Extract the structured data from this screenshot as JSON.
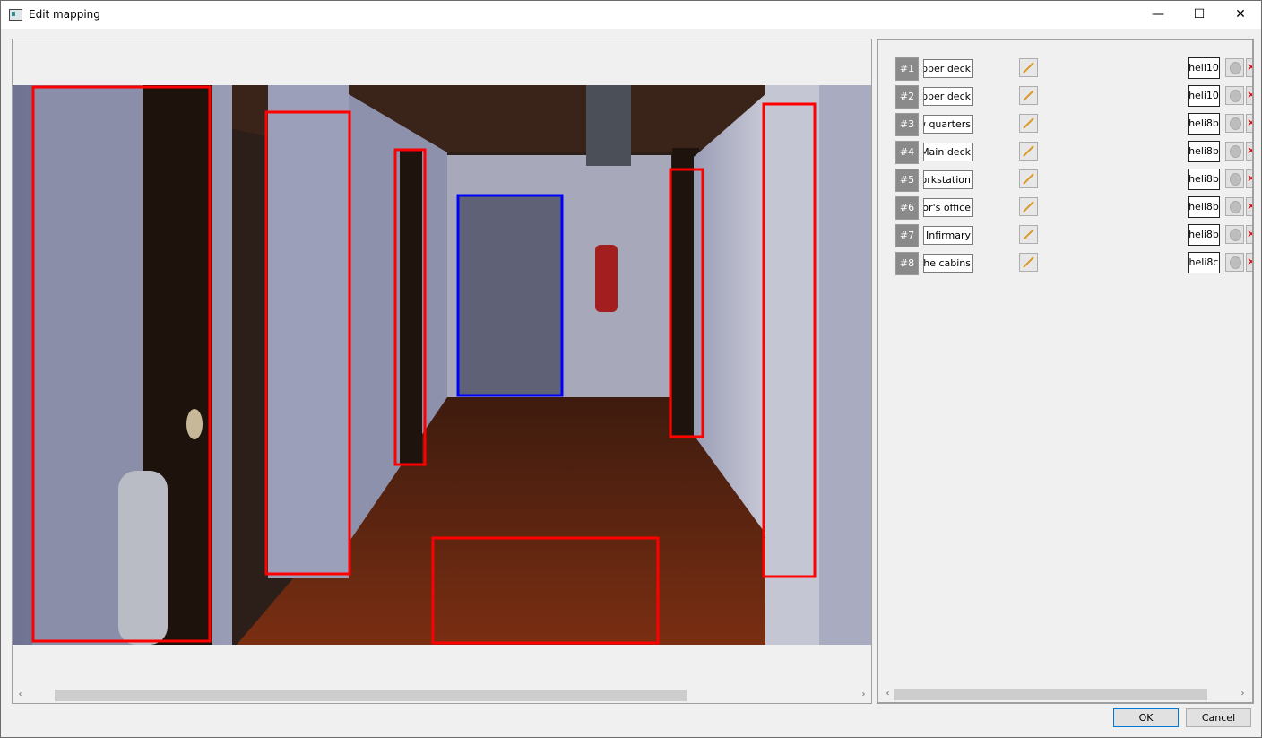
{
  "window": {
    "title": "Edit mapping",
    "minimize_glyph": "—",
    "maximize_glyph": "☐",
    "close_glyph": "✕"
  },
  "image_view": {
    "scroll_left_glyph": "‹",
    "scroll_right_glyph": "›"
  },
  "mappings": [
    {
      "num": "#1",
      "name": "Upper deck",
      "target": "heli10"
    },
    {
      "num": "#2",
      "name": "Upper deck",
      "target": "heli10"
    },
    {
      "num": "#3",
      "name": "Crew quarters",
      "target": "heli8b"
    },
    {
      "num": "#4",
      "name": "Main deck",
      "target": "heli8b"
    },
    {
      "num": "#5",
      "name": "Workstation",
      "target": "heli8b"
    },
    {
      "num": "#6",
      "name": "Doctor's office",
      "target": "heli8b"
    },
    {
      "num": "#7",
      "name": "The Infirmary",
      "target": "heli8b"
    },
    {
      "num": "#8",
      "name": "To the cabins",
      "target": "heli8c"
    }
  ],
  "list_view": {
    "scroll_left_glyph": "‹",
    "scroll_right_glyph": "›"
  },
  "icons": {
    "edit": "pencil-icon",
    "toggle": "circle-icon",
    "delete": "red-x-icon"
  },
  "colors": {
    "region_hotspot": "#ff0000",
    "region_selected": "#0000ff"
  },
  "buttons": {
    "ok": "OK",
    "cancel": "Cancel"
  }
}
